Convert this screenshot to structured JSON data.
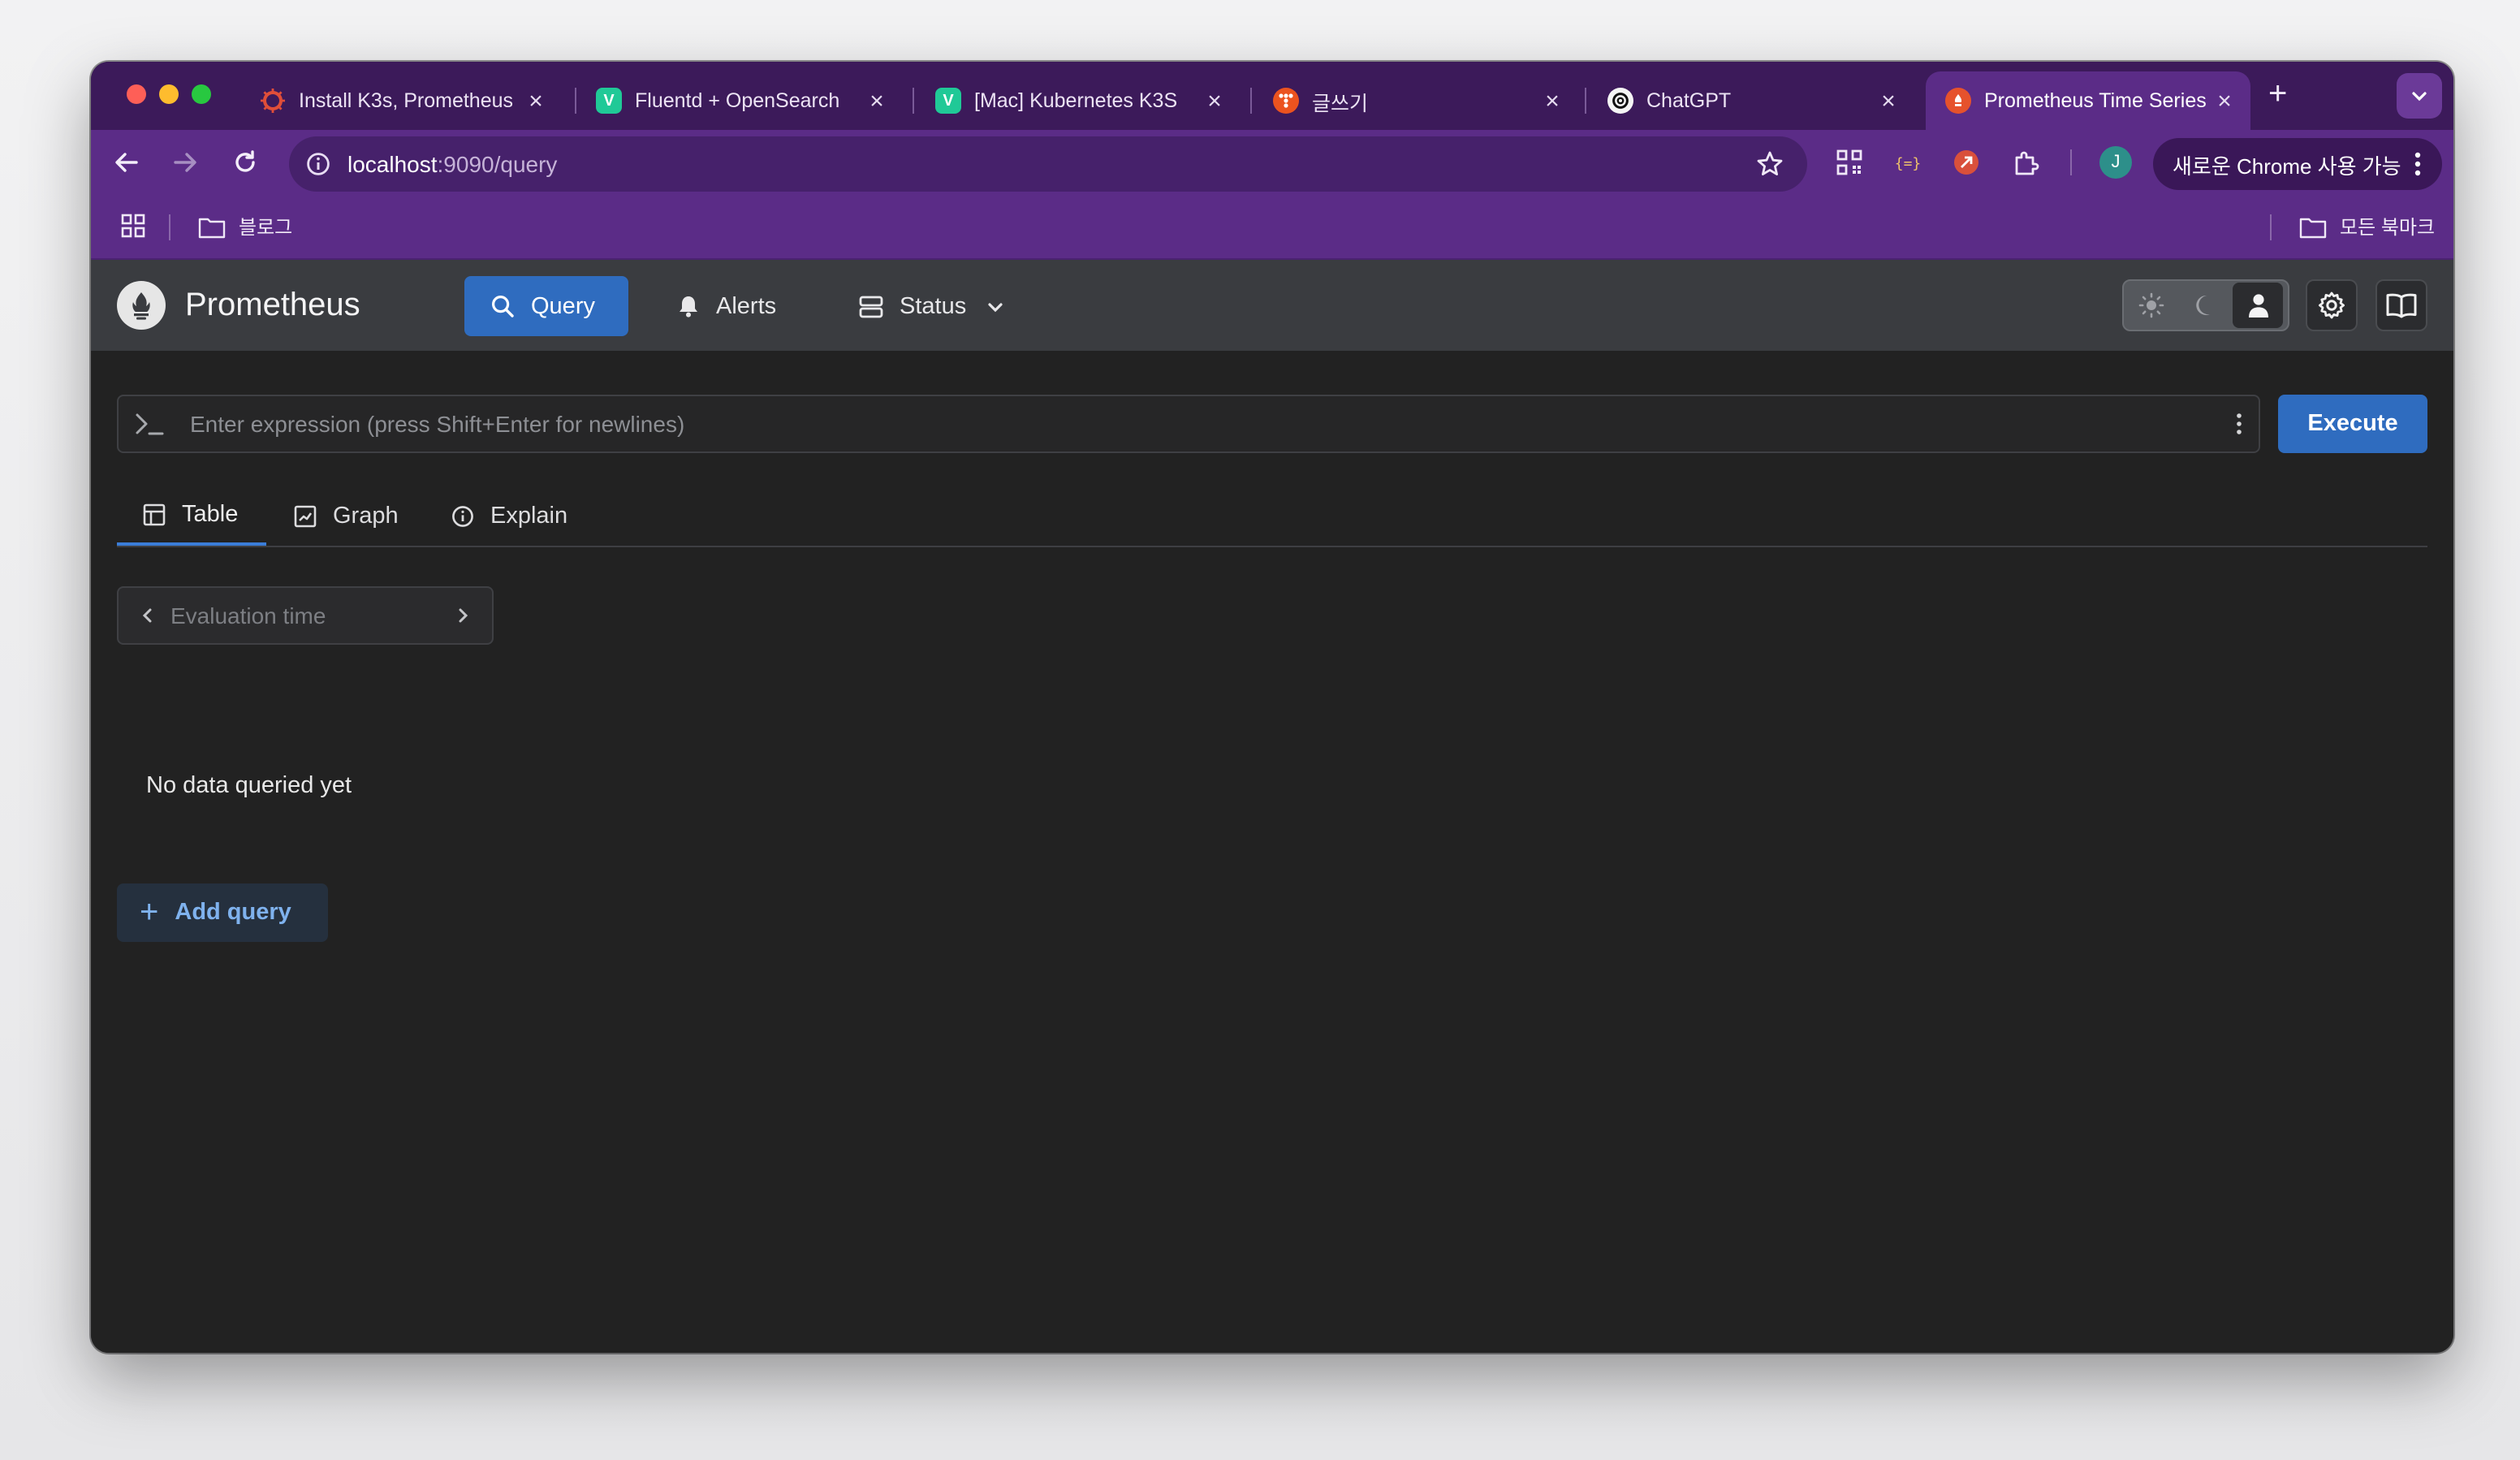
{
  "browser": {
    "tabs": [
      {
        "title": "Install K3s, Prometheus",
        "favicon": "k3s-icon",
        "favicon_color": "#e04e39"
      },
      {
        "title": "Fluentd + OpenSearch",
        "favicon": "velog-icon",
        "favicon_color": "#20c997"
      },
      {
        "title": "[Mac] Kubernetes K3S",
        "favicon": "velog-icon",
        "favicon_color": "#20c997"
      },
      {
        "title": "글쓰기",
        "favicon": "tistory-icon",
        "favicon_color": "#eb531f"
      },
      {
        "title": "ChatGPT",
        "favicon": "openai-icon",
        "favicon_color": "#111111"
      },
      {
        "title": "Prometheus Time Series",
        "favicon": "prometheus-icon",
        "favicon_color": "#e6522c",
        "active": true
      }
    ],
    "url_host": "localhost",
    "url_path": ":9090/query",
    "profile_initial": "J",
    "update_label": "새로운 Chrome 사용 가능",
    "bookmarks": {
      "folder": "블로그",
      "all_bookmarks": "모든 북마크"
    }
  },
  "prometheus": {
    "brand": "Prometheus",
    "nav": {
      "query": "Query",
      "alerts": "Alerts",
      "status": "Status"
    },
    "expression_placeholder": "Enter expression (press Shift+Enter for newlines)",
    "execute_label": "Execute",
    "tabs": {
      "table": "Table",
      "graph": "Graph",
      "explain": "Explain"
    },
    "evaluation_time_placeholder": "Evaluation time",
    "empty_message": "No data queried yet",
    "add_query_label": "Add query"
  },
  "colors": {
    "accent": "#2f6cbf",
    "chrome_theme": "#5b2c87",
    "background": "#222222"
  }
}
